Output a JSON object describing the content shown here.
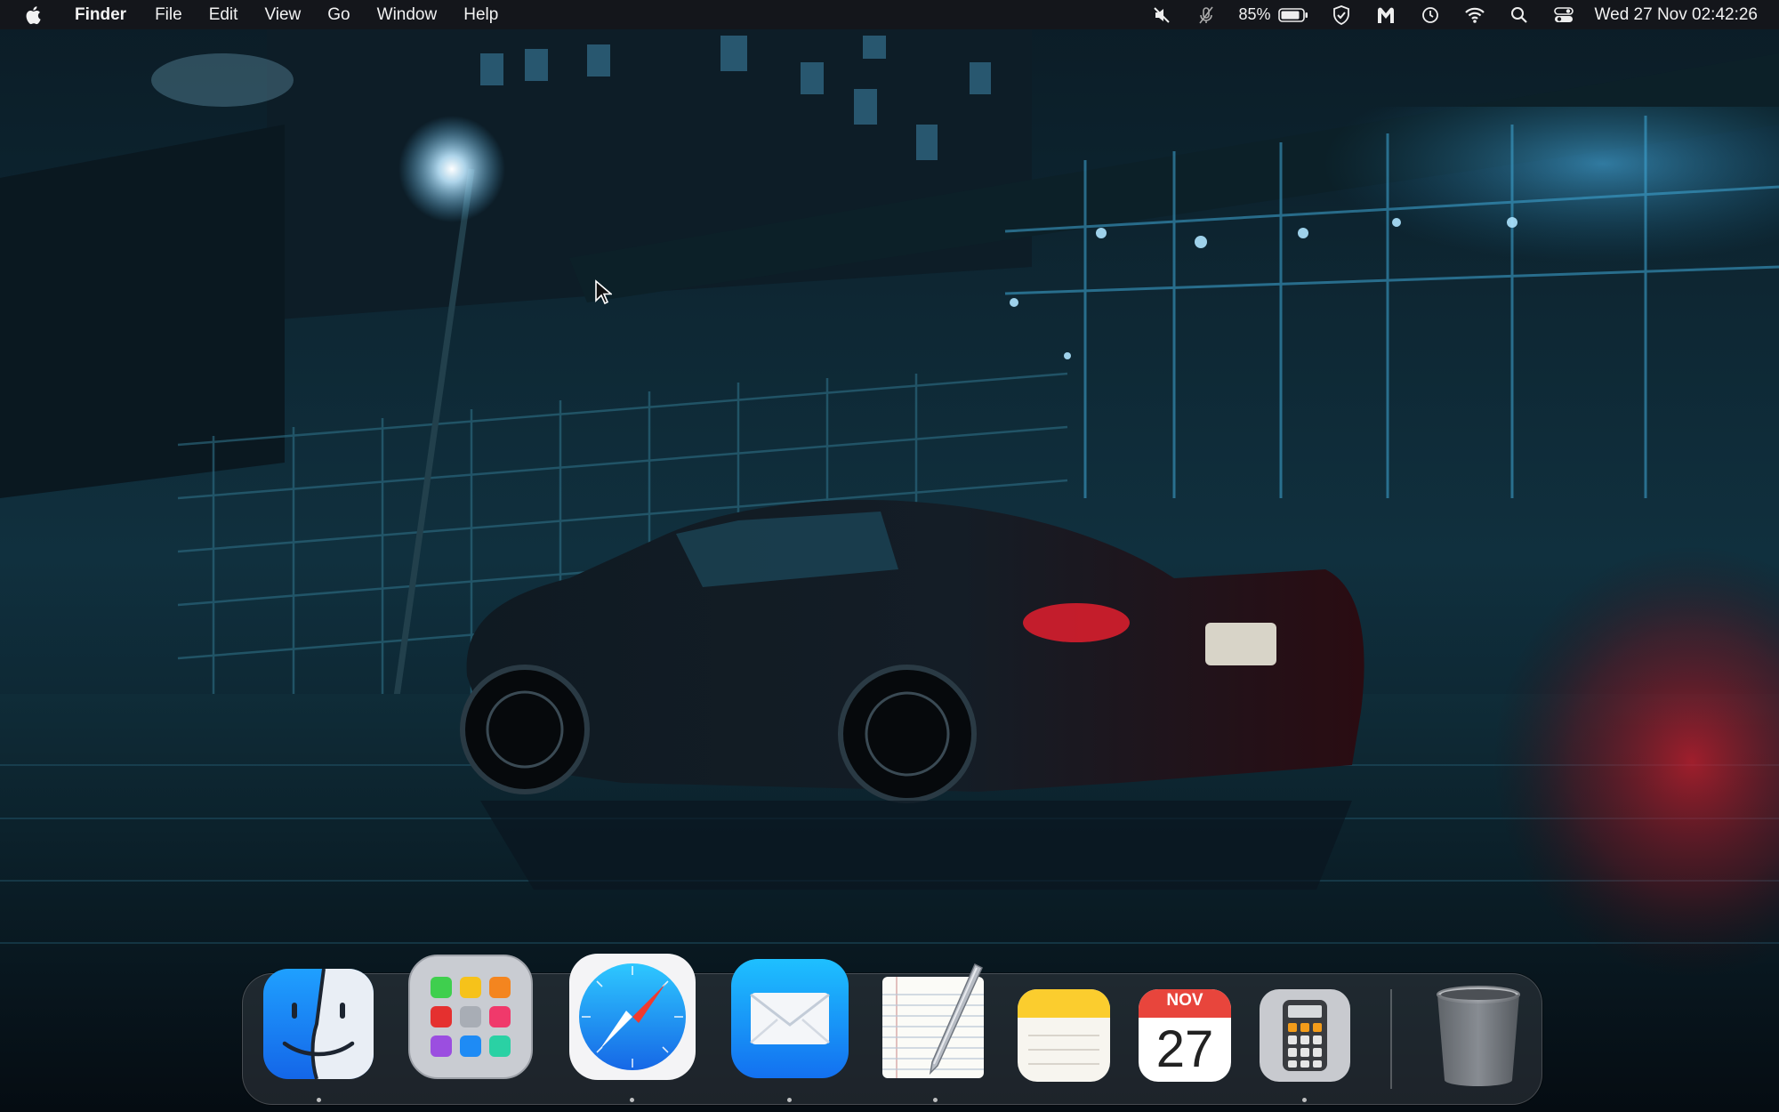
{
  "menubar": {
    "apple_icon": "apple-logo-icon",
    "app_name": "Finder",
    "menus": [
      "File",
      "Edit",
      "View",
      "Go",
      "Window",
      "Help"
    ],
    "status": {
      "icons": [
        "mute-icon",
        "mic-off-icon"
      ],
      "battery_percent": "85%",
      "extra_icons": [
        "shield-icon",
        "malwarebytes-icon",
        "time-machine-icon",
        "wifi-icon",
        "spotlight-search-icon",
        "control-center-icon"
      ],
      "clock": "Wed 27 Nov  02:42:26"
    }
  },
  "dock": {
    "items": [
      {
        "name": "Finder",
        "icon": "finder-icon",
        "running": true
      },
      {
        "name": "Launchpad",
        "icon": "launchpad-icon",
        "running": false
      },
      {
        "name": "Safari",
        "icon": "safari-icon",
        "running": true
      },
      {
        "name": "Mail",
        "icon": "mail-icon",
        "running": true
      },
      {
        "name": "TextEdit",
        "icon": "textedit-icon",
        "running": true
      },
      {
        "name": "Notes",
        "icon": "notes-icon",
        "running": false
      },
      {
        "name": "Calendar",
        "icon": "calendar-icon",
        "running": false
      },
      {
        "name": "Calculator",
        "icon": "calculator-icon",
        "running": true
      },
      {
        "name": "Trash",
        "icon": "trash-icon",
        "running": false
      }
    ],
    "calendar": {
      "month": "NOV",
      "day": "27"
    }
  },
  "colors": {
    "menubar_bg": "#16161a",
    "accent_blue": "#1e8bf5",
    "calendar_red": "#e8453c"
  }
}
